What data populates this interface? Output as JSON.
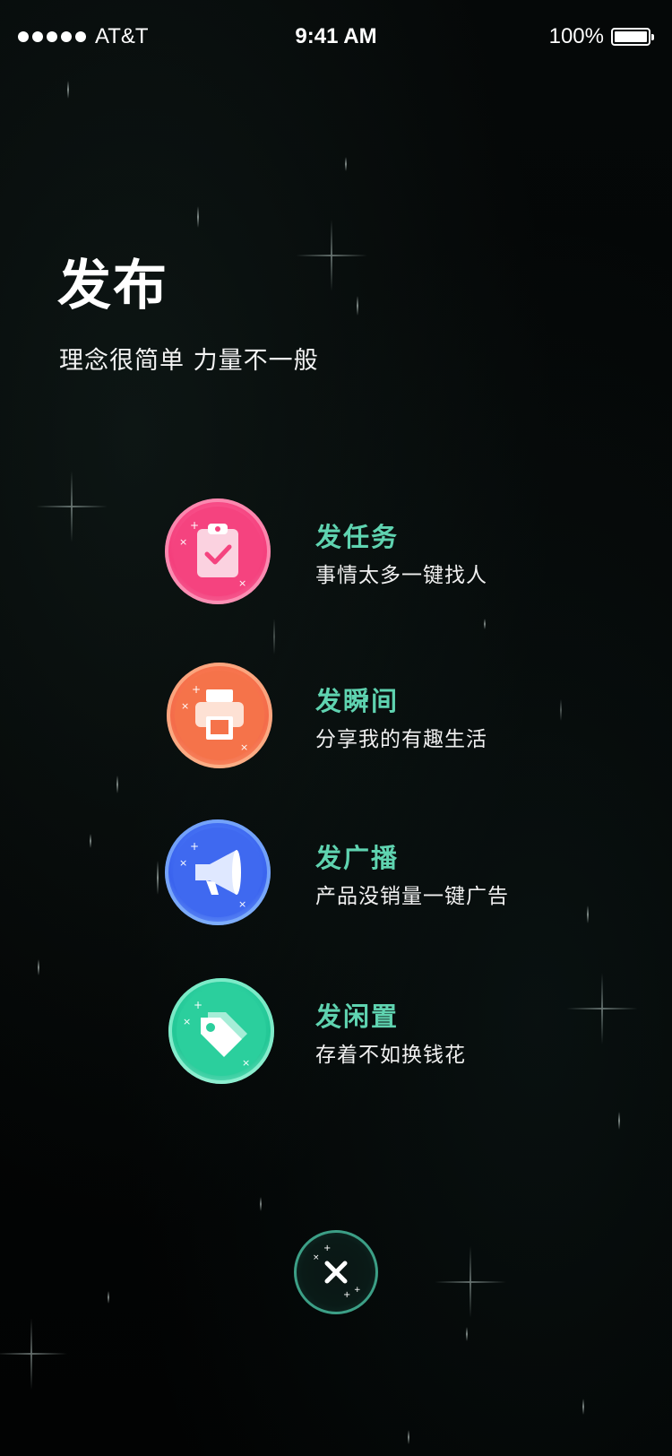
{
  "status_bar": {
    "carrier": "AT&T",
    "time": "9:41 AM",
    "battery_percent": "100%"
  },
  "header": {
    "title": "发布",
    "subtitle": "理念很简单 力量不一般"
  },
  "options": [
    {
      "title": "发任务",
      "description": "事情太多一键找人",
      "icon": "clipboard-check-icon",
      "color": "#f2508a"
    },
    {
      "title": "发瞬间",
      "description": "分享我的有趣生活",
      "icon": "printer-icon",
      "color": "#f47a4c"
    },
    {
      "title": "发广播",
      "description": "产品没销量一键广告",
      "icon": "megaphone-icon",
      "color": "#3d6ff2"
    },
    {
      "title": "发闲置",
      "description": "存着不如换钱花",
      "icon": "price-tag-icon",
      "color": "#27cf9f"
    }
  ],
  "close_button": {
    "icon": "close-icon"
  },
  "colors": {
    "accent": "#5fd3b0",
    "background": "#040707"
  }
}
